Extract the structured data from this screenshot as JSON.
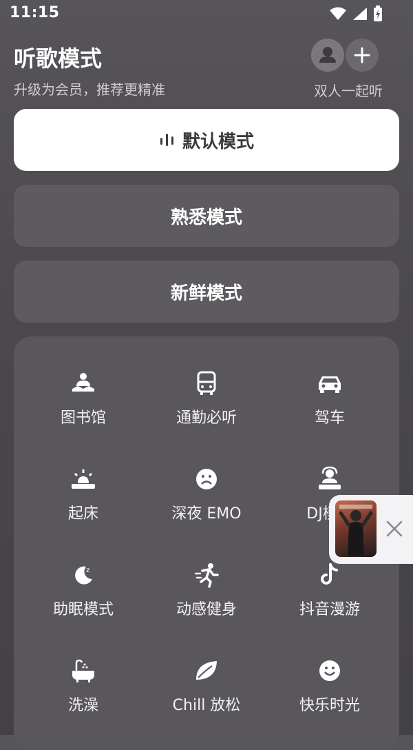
{
  "status_bar": {
    "time": "11:15",
    "icons": [
      "wifi-icon",
      "signal-icon",
      "battery-icon"
    ]
  },
  "header": {
    "title": "听歌模式",
    "subtitle": "升级为会员，推荐更精准",
    "duo_label": "双人一起听"
  },
  "modes": [
    {
      "label": "默认模式",
      "selected": true
    },
    {
      "label": "熟悉模式",
      "selected": false
    },
    {
      "label": "新鲜模式",
      "selected": false
    }
  ],
  "scenes": [
    {
      "label": "图书馆",
      "icon": "library-icon"
    },
    {
      "label": "通勤必听",
      "icon": "bus-icon"
    },
    {
      "label": "驾车",
      "icon": "car-icon"
    },
    {
      "label": "起床",
      "icon": "wake-up-icon"
    },
    {
      "label": "深夜 EMO",
      "icon": "sad-face-icon"
    },
    {
      "label": "DJ模式",
      "icon": "dj-icon"
    },
    {
      "label": "助眠模式",
      "icon": "sleep-moon-icon"
    },
    {
      "label": "动感健身",
      "icon": "running-icon"
    },
    {
      "label": "抖音漫游",
      "icon": "tiktok-icon"
    },
    {
      "label": "洗澡",
      "icon": "bathtub-icon"
    },
    {
      "label": "Chill 放松",
      "icon": "leaf-icon"
    },
    {
      "label": "快乐时光",
      "icon": "smile-face-icon"
    }
  ],
  "colors": {
    "background": "#4b484d",
    "selected_mode_bg": "#ffffff",
    "mode_bg": "#5d5a60"
  }
}
